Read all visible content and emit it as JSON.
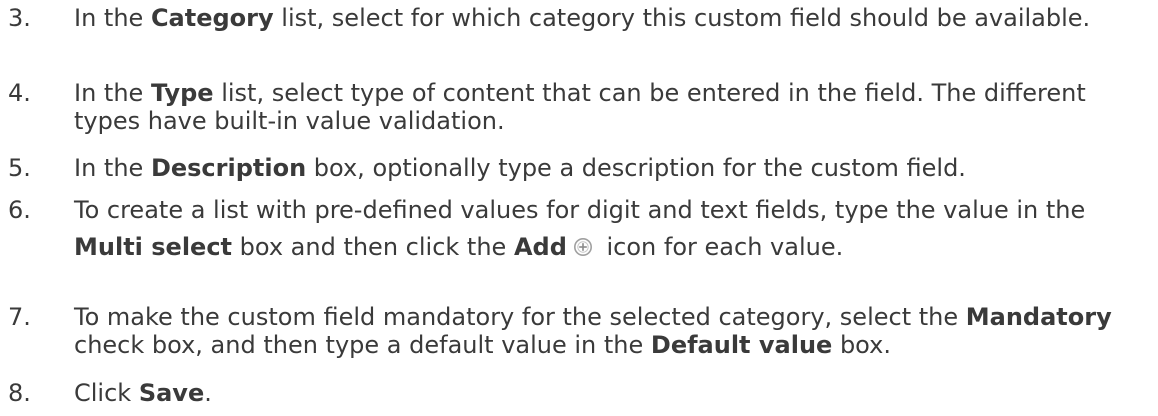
{
  "steps": [
    {
      "number": "3.",
      "parts": [
        "In the ",
        "Category",
        " list, select for which category this custom field should be available."
      ]
    },
    {
      "number": "4.",
      "parts": [
        "In the ",
        "Type",
        " list, select type of content that can be entered in the field. The different types have built-in value validation."
      ]
    },
    {
      "number": "5.",
      "parts": [
        "In the ",
        "Description",
        " box, optionally type a description for the custom field."
      ]
    },
    {
      "number": "6.",
      "parts": [
        "To create a list with pre-defined values for digit and text fields, type the value in the ",
        "Multi select",
        " box and then click the ",
        "Add",
        " icon for each value."
      ],
      "icon": "add-circle-icon"
    },
    {
      "number": "7.",
      "parts": [
        "To make the custom field mandatory for the selected category, select the ",
        "Mandatory",
        " check box, and then type a default value in the ",
        "Default value",
        " box."
      ]
    },
    {
      "number": "8.",
      "parts": [
        "Click ",
        "Save",
        "."
      ]
    }
  ],
  "colors": {
    "text": "#3a3a3a",
    "icon_stroke": "#a0a0a0"
  }
}
